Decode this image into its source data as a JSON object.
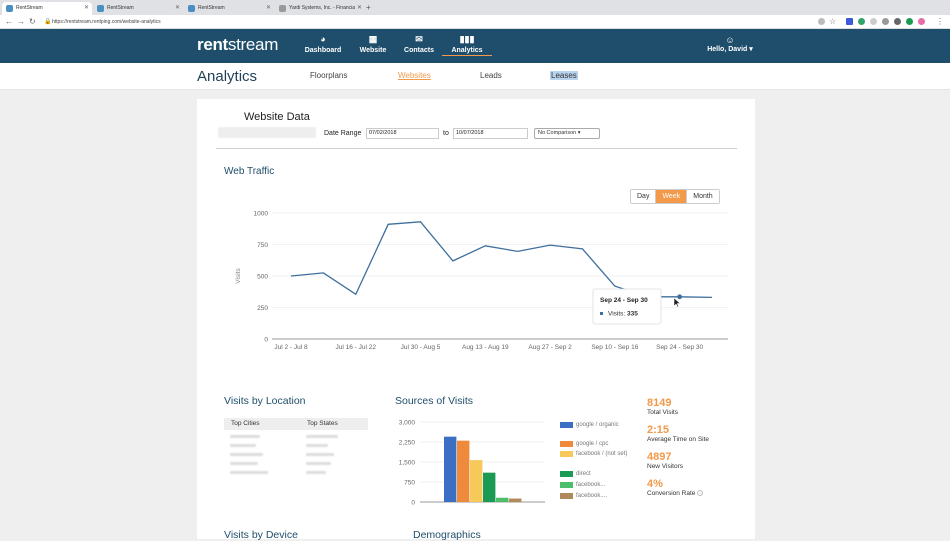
{
  "browser": {
    "tabs": [
      {
        "title": "RentStream",
        "active": true
      },
      {
        "title": "RentStream",
        "active": false
      },
      {
        "title": "RentStream",
        "active": false
      },
      {
        "title": "Yardi Systems, Inc. - Financia",
        "active": false
      }
    ],
    "url": "https://rentstream.rentping.com/website-analytics"
  },
  "header": {
    "logo_bold": "rent",
    "logo_light": "stream",
    "nav": [
      {
        "label": "Dashboard",
        "icon": "dashboard-icon"
      },
      {
        "label": "Website",
        "icon": "website-icon"
      },
      {
        "label": "Contacts",
        "icon": "contacts-icon"
      },
      {
        "label": "Analytics",
        "icon": "analytics-icon"
      }
    ],
    "user_greeting": "Hello, David"
  },
  "subnav": {
    "title": "Analytics",
    "tabs": [
      "Floorplans",
      "Websites",
      "Leads",
      "Leases"
    ]
  },
  "website_data": {
    "title": "Website Data",
    "date_range_label": "Date Range",
    "from": "07/02/2018",
    "to_label": "to",
    "to": "10/07/2018",
    "comparison": "No Comparison"
  },
  "traffic": {
    "title": "Web Traffic",
    "periods": [
      "Day",
      "Week",
      "Month"
    ],
    "active_period": "Week",
    "tooltip_title": "Sep 24 - Sep 30",
    "tooltip_label": "Visits:",
    "tooltip_value": "335"
  },
  "location": {
    "title": "Visits by Location",
    "col1": "Top Cities",
    "col2": "Top States"
  },
  "sources": {
    "title": "Sources of Visits"
  },
  "stats": [
    {
      "value": "8149",
      "label": "Total Visits"
    },
    {
      "value": "2:15",
      "label": "Average Time on Site"
    },
    {
      "value": "4897",
      "label": "New Visitors"
    },
    {
      "value": "4%",
      "label": "Conversion Rate"
    }
  ],
  "bottom": {
    "device_title": "Visits by Device",
    "demographics_title": "Demographics"
  },
  "colors": {
    "brand": "#1f4e6c",
    "accent": "#f2994a",
    "line": "#3f6f9c"
  },
  "chart_data": [
    {
      "type": "line",
      "title": "Web Traffic",
      "ylabel": "Visits",
      "ylim": [
        0,
        1000
      ],
      "yticks": [
        0,
        250,
        500,
        750,
        1000
      ],
      "xticklabels": [
        "Jul 2 - Jul 8",
        "Jul 16 - Jul 22",
        "Jul 30 - Aug 5",
        "Aug 13 - Aug 19",
        "Aug 27 - Sep 2",
        "Sep 10 - Sep 16",
        "Sep 24 - Sep 30"
      ],
      "x": [
        "Jul 2 - Jul 8",
        "Jul 9 - Jul 15",
        "Jul 16 - Jul 22",
        "Jul 23 - Jul 29",
        "Jul 30 - Aug 5",
        "Aug 6 - Aug 12",
        "Aug 13 - Aug 19",
        "Aug 20 - Aug 26",
        "Aug 27 - Sep 2",
        "Sep 3 - Sep 9",
        "Sep 10 - Sep 16",
        "Sep 17 - Sep 23",
        "Sep 24 - Sep 30",
        "Oct 1 - Oct 7"
      ],
      "values": [
        500,
        525,
        355,
        910,
        930,
        620,
        740,
        695,
        745,
        715,
        420,
        335,
        335,
        330
      ]
    },
    {
      "type": "bar",
      "title": "Sources of Visits",
      "ylim": [
        0,
        3000
      ],
      "yticks": [
        0,
        750,
        1500,
        2250,
        3000
      ],
      "yticklabels": [
        "0",
        "750",
        "1,500",
        "2,250",
        "3,000"
      ],
      "categories": [
        "google / organic",
        "google / cpc",
        "facebook / (not set)",
        "direct",
        "facebook...",
        "facebook...."
      ],
      "values": [
        2450,
        2300,
        1570,
        1100,
        160,
        130
      ],
      "colors": [
        "#3a6fc4",
        "#ef8a3b",
        "#f7c85a",
        "#1a9a52",
        "#4cbf6a",
        "#b08a5a"
      ]
    }
  ]
}
